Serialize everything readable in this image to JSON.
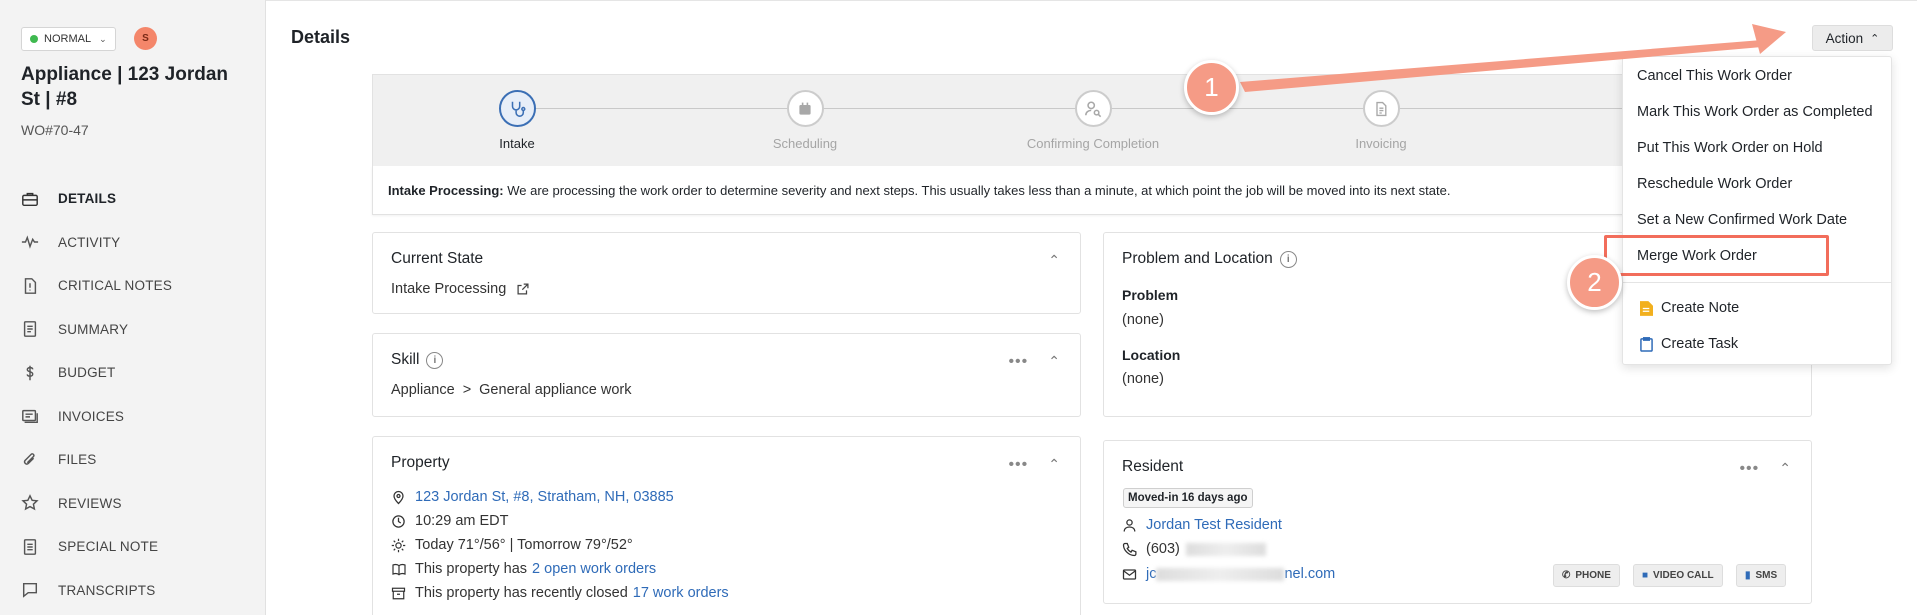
{
  "sidebar": {
    "priority": "NORMAL",
    "avatar_initial": "S",
    "title": "Appliance | 123 Jordan St | #8",
    "wo_number": "WO#70-47",
    "nav": [
      {
        "label": "DETAILS",
        "icon": "briefcase-icon",
        "active": true
      },
      {
        "label": "ACTIVITY",
        "icon": "pulse-icon"
      },
      {
        "label": "CRITICAL NOTES",
        "icon": "alert-document-icon"
      },
      {
        "label": "SUMMARY",
        "icon": "document-icon"
      },
      {
        "label": "BUDGET",
        "icon": "dollar-icon"
      },
      {
        "label": "INVOICES",
        "icon": "invoice-icon"
      },
      {
        "label": "FILES",
        "icon": "paperclip-icon"
      },
      {
        "label": "REVIEWS",
        "icon": "star-icon"
      },
      {
        "label": "SPECIAL NOTE",
        "icon": "note-icon"
      },
      {
        "label": "TRANSCRIPTS",
        "icon": "chat-icon"
      }
    ]
  },
  "header": {
    "title": "Details",
    "action_label": "Action"
  },
  "steps": [
    {
      "label": "Intake",
      "icon": "stethoscope-icon",
      "active": true
    },
    {
      "label": "Scheduling",
      "icon": "calendar-icon"
    },
    {
      "label": "Confirming Completion",
      "icon": "user-search-icon"
    },
    {
      "label": "Invoicing",
      "icon": "invoice-icon"
    }
  ],
  "intake": {
    "label": "Intake Processing:",
    "text": "We are processing the work order to determine severity and next steps. This usually takes less than a minute, at which point the job will be moved into its next state."
  },
  "current_state": {
    "title": "Current State",
    "value": "Intake Processing"
  },
  "skill": {
    "title": "Skill",
    "category": "Appliance",
    "separator": ">",
    "sub": "General appliance work"
  },
  "property": {
    "title": "Property",
    "address": "123 Jordan St, #8, Stratham, NH, 03885",
    "time": "10:29 am EDT",
    "weather": "Today 71°/56° | Tomorrow 79°/52°",
    "open_prefix": "This property has",
    "open_link": "2 open work orders",
    "closed_prefix": "This property has recently closed",
    "closed_link": "17 work orders"
  },
  "problem_location": {
    "title": "Problem and Location",
    "problem_label": "Problem",
    "problem_value": "(none)",
    "location_label": "Location",
    "location_value": "(none)"
  },
  "resident": {
    "title": "Resident",
    "tag": "Moved-in 16 days ago",
    "name": "Jordan Test Resident",
    "phone_visible": "(603)",
    "email_start": "jc",
    "email_end": "nel.com",
    "buttons": [
      "PHONE",
      "VIDEO CALL",
      "SMS"
    ]
  },
  "action_menu": {
    "items": [
      "Cancel This Work Order",
      "Mark This Work Order as Completed",
      "Put This Work Order on Hold",
      "Reschedule Work Order",
      "Set a New Confirmed Work Date",
      "Merge Work Order"
    ],
    "extra": [
      {
        "label": "Create Note",
        "icon": "note-icon",
        "color": "#f2b01e"
      },
      {
        "label": "Create Task",
        "icon": "clipboard-icon",
        "color": "#2f6bb8"
      }
    ]
  },
  "callouts": [
    "1",
    "2"
  ],
  "colors": {
    "accent": "#2f6bb8",
    "callout": "#f59b86",
    "highlight": "#f26d5b",
    "status_green": "#3fb950"
  }
}
